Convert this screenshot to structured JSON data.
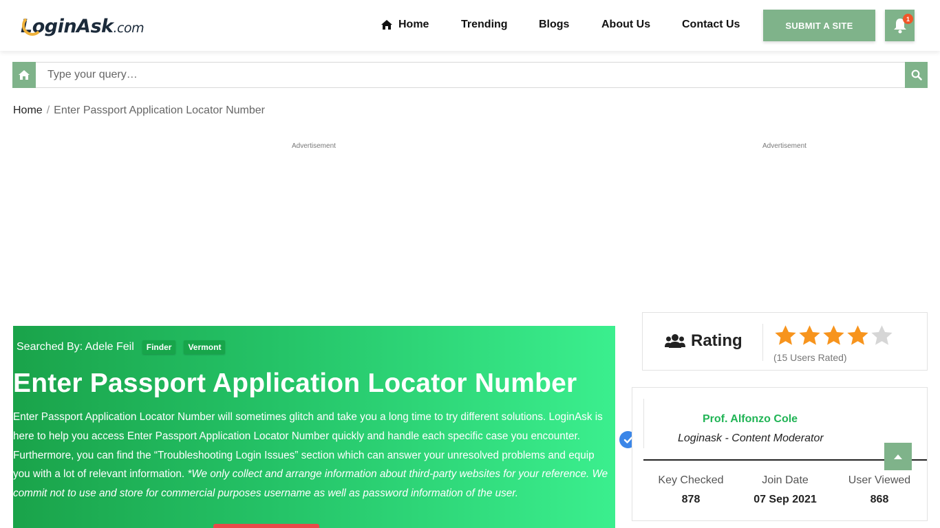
{
  "header": {
    "logo_main": "LoginAsk",
    "logo_suffix": ".com",
    "nav": [
      {
        "label": "Home",
        "icon": "home-icon"
      },
      {
        "label": "Trending"
      },
      {
        "label": "Blogs"
      },
      {
        "label": "About Us"
      },
      {
        "label": "Contact Us"
      }
    ],
    "submit_label": "SUBMIT A SITE",
    "notification_count": "1"
  },
  "search": {
    "placeholder": "Type your query…",
    "home_icon": "home-icon",
    "search_icon": "search-icon"
  },
  "breadcrumb": {
    "home": "Home",
    "separator": "/",
    "current": "Enter Passport Application Locator Number"
  },
  "ads": {
    "left_label": "Advertisement",
    "right_label": "Advertisement"
  },
  "hero": {
    "searched_by": "Searched By: Adele Feil",
    "tags": [
      "Finder",
      "Vermont"
    ],
    "title": "Enter Passport Application Locator Number",
    "description_plain": "Enter Passport Application Locator Number will sometimes glitch and take you a long time to try different solutions. LoginAsk is here to help you access Enter Passport Application Locator Number quickly and handle each specific case you encounter. Furthermore, you can find the “Troubleshooting Login Issues” section which can answer your unresolved problems and equip you with a lot of relevant information. ",
    "description_italic": "*We only collect and arrange information about third-party websites for your reference. We commit not to use and store for commercial purposes username as well as password information of the user."
  },
  "rating": {
    "label": "Rating",
    "icon": "users-icon",
    "stars_filled": 4,
    "stars_total": 5,
    "users_rated": "(15 Users Rated)",
    "star_color": "#f7941d",
    "star_empty_color": "#d6d6d6"
  },
  "author": {
    "name": "Prof. Alfonzo Cole",
    "role": "Loginask - Content Moderator",
    "stats": [
      {
        "label": "Key Checked",
        "value": "878"
      },
      {
        "label": "Join Date",
        "value": "07 Sep 2021"
      },
      {
        "label": "User Viewed",
        "value": "868"
      }
    ]
  },
  "colors": {
    "accent": "#7fb38a",
    "hero_start": "#1aa34a",
    "hero_end": "#3bef8e",
    "author_name": "#20b455",
    "badge": "#f0572a",
    "verify": "#3b86e8"
  }
}
